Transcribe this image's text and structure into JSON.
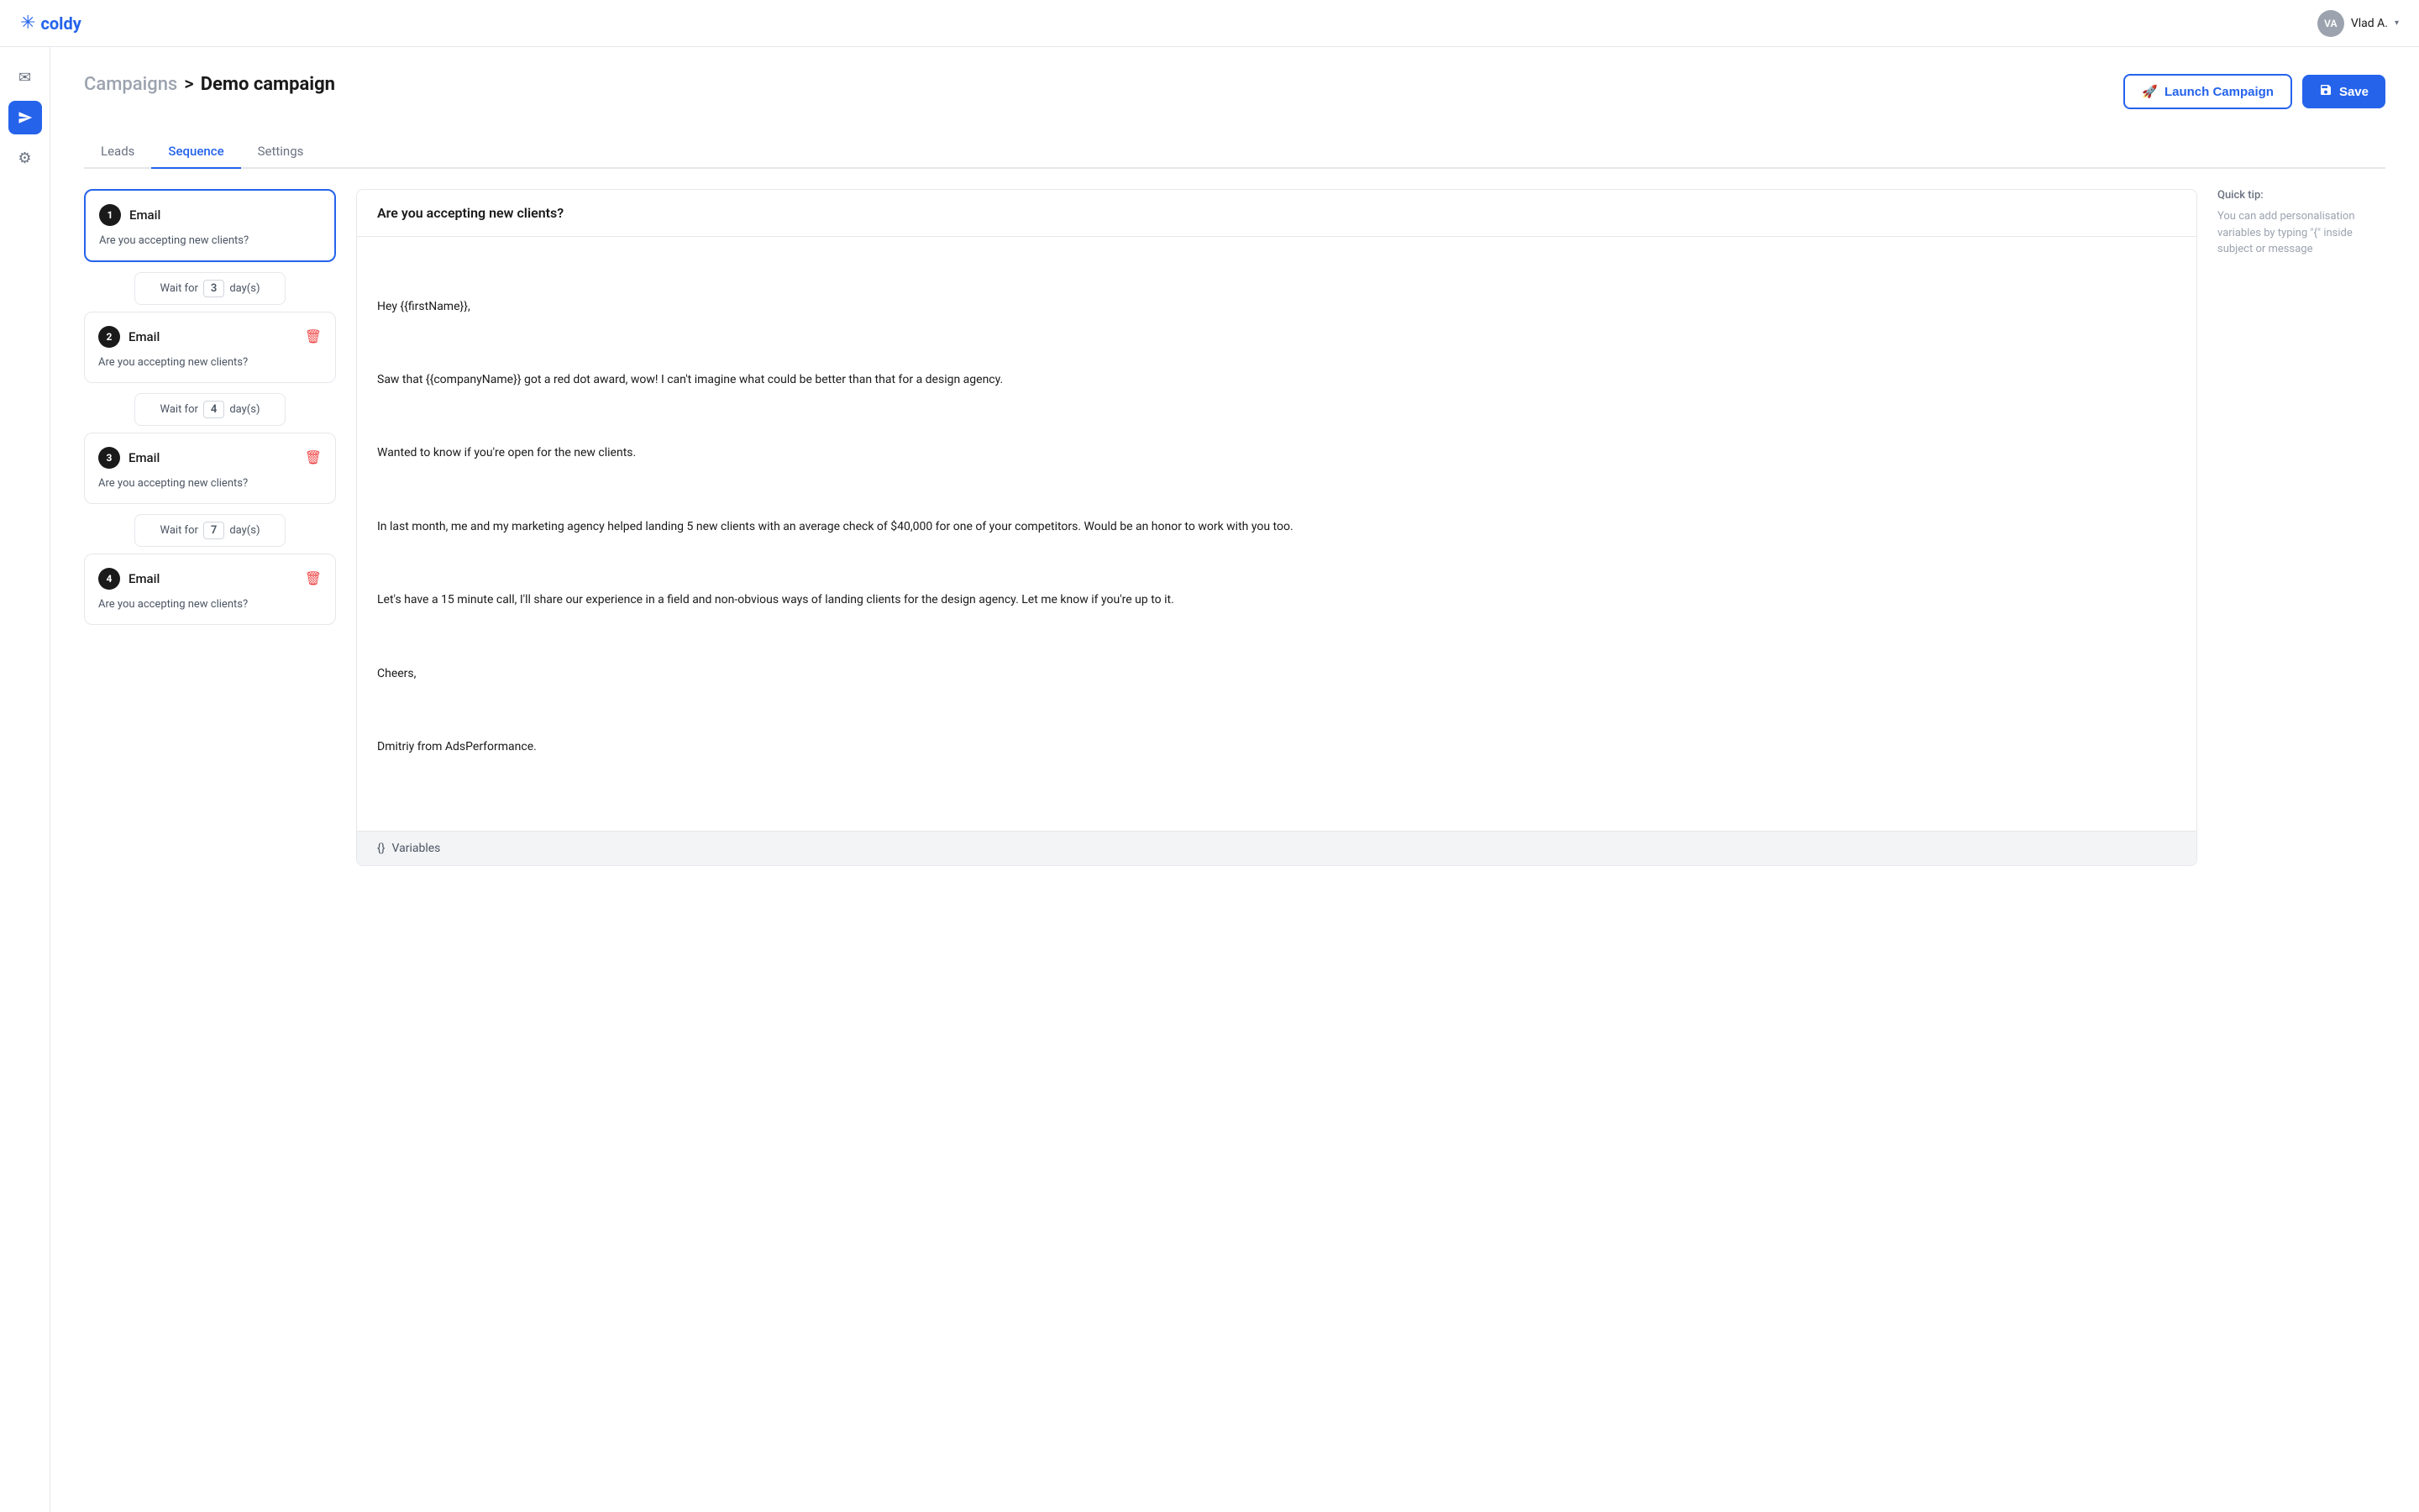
{
  "topnav": {
    "logo_icon": "✳",
    "logo_text": "coldy",
    "user_initials": "VA",
    "user_name": "Vlad A.",
    "chevron": "▾"
  },
  "sidebar": {
    "icons": [
      {
        "id": "mail-icon",
        "symbol": "✉",
        "active": false
      },
      {
        "id": "send-icon",
        "symbol": "➤",
        "active": true
      },
      {
        "id": "settings-icon",
        "symbol": "⚙",
        "active": false
      }
    ]
  },
  "breadcrumb": {
    "parent": "Campaigns",
    "separator": ">",
    "current": "Demo campaign"
  },
  "header": {
    "launch_label": "Launch Campaign",
    "save_label": "Save"
  },
  "tabs": [
    {
      "id": "leads",
      "label": "Leads",
      "active": false
    },
    {
      "id": "sequence",
      "label": "Sequence",
      "active": true
    },
    {
      "id": "settings",
      "label": "Settings",
      "active": false
    }
  ],
  "sequence": {
    "items": [
      {
        "num": "1",
        "type": "Email",
        "subject": "Are you accepting new clients?",
        "selected": true,
        "show_delete": false
      },
      {
        "num": "2",
        "type": "Email",
        "subject": "Are you accepting new clients?",
        "selected": false,
        "show_delete": true
      },
      {
        "num": "3",
        "type": "Email",
        "subject": "Are you accepting new clients?",
        "selected": false,
        "show_delete": true
      },
      {
        "num": "4",
        "type": "Email",
        "subject": "Are you accepting new clients?",
        "selected": false,
        "show_delete": true
      }
    ],
    "waits": [
      {
        "after_item": 1,
        "days": "3"
      },
      {
        "after_item": 2,
        "days": "4"
      },
      {
        "after_item": 3,
        "days": "7"
      }
    ],
    "wait_label": "Wait for",
    "wait_suffix": "day(s)"
  },
  "email": {
    "subject": "Are you accepting new clients?",
    "body_line1": "Hey {{firstName}},",
    "body_line2": "Saw that {{companyName}} got a red dot award, wow! I can't imagine what could be better than that for a design agency.",
    "body_line3": "Wanted to know if you're open for the new clients.",
    "body_line4": "In last month, me and my marketing agency helped landing 5 new clients with an average check of $40,000 for one of your competitors. Would be an honor to work with you too.",
    "body_line5": "Let's have a 15 minute call, I'll share our experience in a field and non-obvious ways of landing clients for the design agency. Let me know if you're up to it.",
    "body_line6": "Cheers,",
    "body_line7": "Dmitriy from AdsPerformance.",
    "variables_label": "Variables",
    "variables_icon": "{}"
  },
  "quick_tip": {
    "title": "Quick tip:",
    "body": "You can add personalisation variables by typing \"{\" inside subject or message"
  }
}
